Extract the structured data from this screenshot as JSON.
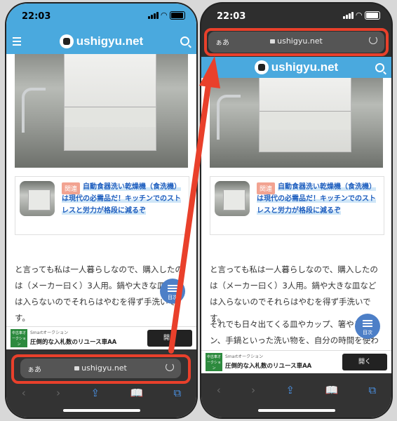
{
  "status": {
    "time": "22:03"
  },
  "site": {
    "logo_text": "ushigyu.net"
  },
  "related": {
    "badge": "関連",
    "title": "自動食器洗い乾燥機（食洗機）は現代の必需品だ！キッチンでのストレスと労力が格段に減るぞ"
  },
  "article": {
    "para1": "と言っても私は一人暮らしなので、購入したのは（メーカー曰く）3人用。鍋や大きな皿などは入らないのでそれらはやむを得ず手洗いです。",
    "para2": "それでも日々出てくる皿やカップ、箸やスプーン、手鍋といった洗い物を、自分の時間を使わず"
  },
  "toc": {
    "label": "目次"
  },
  "ad": {
    "small_text": "Smartオークション",
    "main_text": "圧倒的な入札数のリユース車AA",
    "logo_text": "中古車オークション",
    "button": "開く"
  },
  "address_bar": {
    "aa": "ぁあ",
    "url": "ushigyu.net"
  },
  "toolbar": {
    "back": "‹",
    "forward": "›",
    "share": "⇪",
    "bookmarks": "📖",
    "tabs": "⧉"
  },
  "annotation_color": "#e9402b",
  "accent_color": "#4aa9de"
}
